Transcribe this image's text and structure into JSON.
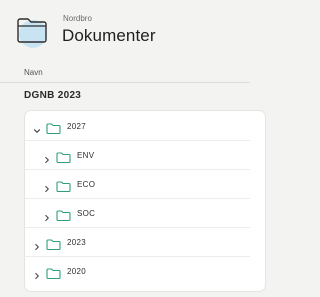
{
  "header": {
    "subtitle": "Nordbro",
    "title": "Dokumenter",
    "folder_icon": "folder-icon"
  },
  "columns": {
    "name": "Navn"
  },
  "section": {
    "title": "DGNB 2023"
  },
  "tree": {
    "root": {
      "label": "2027",
      "expanded": true
    },
    "children": [
      {
        "label": "ENV",
        "expanded": false
      },
      {
        "label": "ECO",
        "expanded": false
      },
      {
        "label": "SOC",
        "expanded": false
      }
    ],
    "siblings": [
      {
        "label": "2023",
        "expanded": false
      },
      {
        "label": "2020",
        "expanded": false
      }
    ]
  },
  "colors": {
    "folder_outline": "#2f9e7a",
    "accent_halo": "#bfe0f3",
    "background": "#f3f3f1"
  }
}
